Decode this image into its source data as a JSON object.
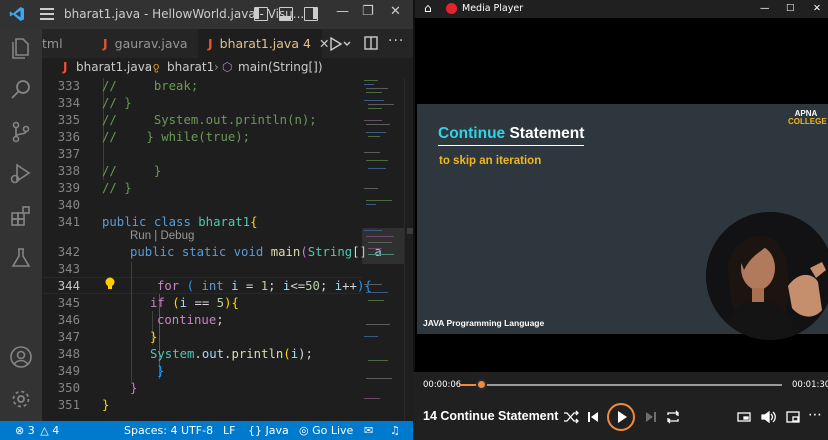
{
  "vscode": {
    "window_title": "bharat1.java - HellowWorld.java - Visu...",
    "tabs": [
      {
        "label": "tml",
        "icon": "html-file-icon"
      },
      {
        "label": "gaurav.java",
        "icon": "java-file-icon"
      },
      {
        "label": "bharat1.java",
        "problems": "4",
        "icon": "java-file-icon",
        "active": true
      }
    ],
    "breadcrumb": [
      "bharat1.java",
      "bharat1",
      "main(String[])"
    ],
    "codelens": "Run | Debug",
    "line_numbers": [
      "333",
      "334",
      "335",
      "336",
      "337",
      "338",
      "339",
      "340",
      "341",
      "342",
      "343",
      "344",
      "345",
      "346",
      "347",
      "348",
      "349",
      "350",
      "351"
    ],
    "current_line": "344",
    "code": {
      "l333": [
        "//",
        "     break;"
      ],
      "l334": [
        "// }"
      ],
      "l335": [
        "//",
        "     System.out.println(n);"
      ],
      "l336": [
        "//",
        "    } while(true);"
      ],
      "l338": [
        "//",
        "     }"
      ],
      "l339": [
        "// }"
      ],
      "l341": [
        "public",
        "class",
        "bharat1",
        "{"
      ],
      "l342": [
        "public",
        "static",
        "void",
        "main",
        "(",
        "String",
        "[]",
        "a"
      ],
      "l344": [
        "for",
        "(",
        "int",
        "i",
        "=",
        "1",
        ";",
        "i",
        "<=",
        "50",
        ";",
        "i",
        "++",
        ")",
        "{"
      ],
      "l345": [
        "if",
        "(",
        "i",
        "==",
        "5",
        ")",
        "{"
      ],
      "l346": [
        "continue",
        ";"
      ],
      "l347": [
        "}"
      ],
      "l348": [
        "System",
        ".",
        "out",
        ".",
        "println",
        "(",
        "i",
        ");"
      ],
      "l349": [
        "}"
      ],
      "l350": [
        "}"
      ],
      "l351": [
        "}"
      ]
    },
    "status": {
      "errors": "3",
      "warnings": "4",
      "spaces": "Spaces: 4",
      "encoding": "UTF-8",
      "eol": "LF",
      "language": "Java",
      "golive": "Go Live"
    },
    "colors": {
      "accent": "#007acc",
      "editor_bg": "#1e1e1e"
    }
  },
  "player": {
    "app_title": "Media Player",
    "slide": {
      "title_highlight": "Continue",
      "title_rest": " Statement",
      "subtitle": "to skip an iteration",
      "footer": "JAVA Programming Language",
      "brand_line1": "APNA",
      "brand_line2": "COLLEGE"
    },
    "time_elapsed": "00:00:06",
    "time_total": "00:01:30",
    "progress_fraction": 0.067,
    "video_title": "14 Continue Statement",
    "accent": "#f28a3d"
  }
}
